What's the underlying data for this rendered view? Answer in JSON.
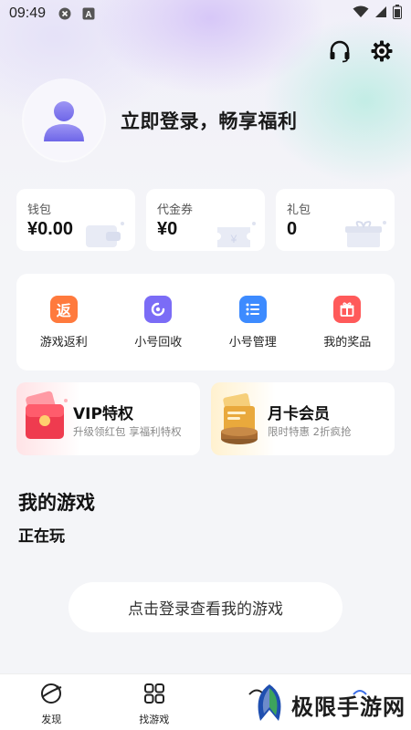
{
  "status_bar": {
    "time": "09:49",
    "notif_a": "A"
  },
  "top_actions": {
    "support_icon": "headset-icon",
    "settings_icon": "gear-icon"
  },
  "profile": {
    "login_prompt": "立即登录，畅享福利"
  },
  "wallet": [
    {
      "label": "钱包",
      "value": "¥0.00"
    },
    {
      "label": "代金券",
      "value": "¥0"
    },
    {
      "label": "礼包",
      "value": "0"
    }
  ],
  "services": [
    {
      "label": "游戏返利",
      "icon_char": "返",
      "color": "#ff7a3d"
    },
    {
      "label": "小号回收",
      "icon_char": "",
      "color": "#7b6cf6"
    },
    {
      "label": "小号管理",
      "icon_char": "",
      "color": "#3d8bff"
    },
    {
      "label": "我的奖品",
      "icon_char": "",
      "color": "#ff5a5a"
    }
  ],
  "promos": [
    {
      "title": "VIP特权",
      "subtitle": "升级领红包 享福利特权"
    },
    {
      "title": "月卡会员",
      "subtitle": "限时特惠 2折疯抢"
    }
  ],
  "my_games": {
    "title": "我的游戏",
    "subtitle": "正在玩",
    "login_button": "点击登录查看我的游戏"
  },
  "tabbar": [
    {
      "label": "发现",
      "icon": "planet-icon"
    },
    {
      "label": "找游戏",
      "icon": "grid-icon"
    },
    {
      "label": "",
      "icon": "tab3-icon"
    },
    {
      "label": "",
      "icon": "tab4-icon"
    }
  ],
  "watermark": {
    "text": "极限手游网"
  }
}
